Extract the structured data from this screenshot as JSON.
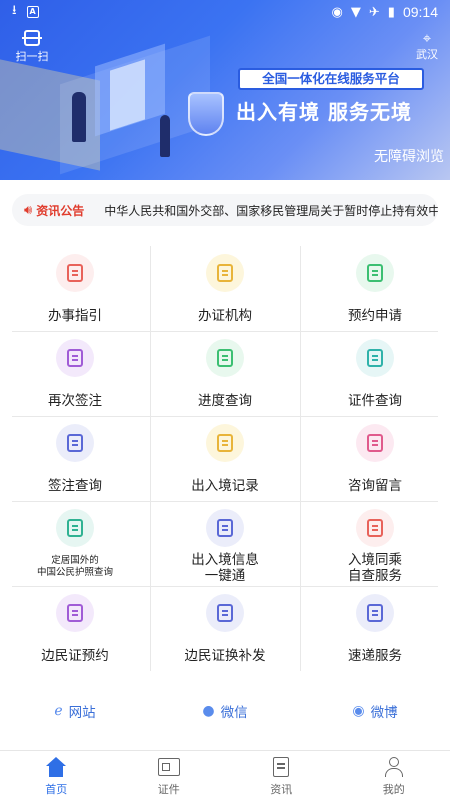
{
  "status_bar": {
    "time": "09:14",
    "a_icon_letter": "A"
  },
  "header": {
    "scan_label": "扫一扫",
    "city": "武汉",
    "platform_tag": "全国一体化在线服务平台",
    "slogan": "出入有境  服务无境",
    "accessibility": "无障碍浏览"
  },
  "notice": {
    "tag": "资讯公告",
    "text": "中华人民共和国外交部、国家移民管理局关于暂时停止持有效中"
  },
  "colors": {
    "accent": "#2f6fe6",
    "notice_red": "#e03c2d",
    "link_blue": "#3a6fd8"
  },
  "services": [
    {
      "label": "办事指引",
      "icon": "guide-icon",
      "bg": "#fdeeee",
      "fg": "#e8625a"
    },
    {
      "label": "办证机构",
      "icon": "building-icon",
      "bg": "#fdf6dc",
      "fg": "#e8b43a"
    },
    {
      "label": "预约申请",
      "icon": "appointment-icon",
      "bg": "#e8f8ee",
      "fg": "#3cbf72"
    },
    {
      "label": "再次签注",
      "icon": "re-endorse-icon",
      "bg": "#f3e9fb",
      "fg": "#a05cd6"
    },
    {
      "label": "进度查询",
      "icon": "progress-icon",
      "bg": "#e8f8ee",
      "fg": "#3cbf72"
    },
    {
      "label": "证件查询",
      "icon": "id-card-icon",
      "bg": "#e6f6f6",
      "fg": "#2fb2aa"
    },
    {
      "label": "签注查询",
      "icon": "endorse-query-icon",
      "bg": "#ebedfa",
      "fg": "#5a68d6"
    },
    {
      "label": "出入境记录",
      "icon": "record-icon",
      "bg": "#fdf6dc",
      "fg": "#e8b43a"
    },
    {
      "label": "咨询留言",
      "icon": "consult-icon",
      "bg": "#fce9f1",
      "fg": "#e05a8c"
    },
    {
      "label_lines": [
        "定居国外的",
        "中国公民护照查询"
      ],
      "icon": "passport-icon",
      "bg": "#e6f6f2",
      "fg": "#2fb292"
    },
    {
      "label_lines": [
        "出入境信息",
        "一键通"
      ],
      "icon": "info-click-icon",
      "bg": "#ebedfa",
      "fg": "#5a68d6"
    },
    {
      "label_lines": [
        "入境同乘",
        "自查服务"
      ],
      "icon": "passenger-check-icon",
      "bg": "#fdeeee",
      "fg": "#e8625a"
    },
    {
      "label": "边民证预约",
      "icon": "border-card-icon",
      "bg": "#f3e9fb",
      "fg": "#a05cd6"
    },
    {
      "label": "边民证换补发",
      "icon": "border-reissue-icon",
      "bg": "#ebedfa",
      "fg": "#5a68d6"
    },
    {
      "label": "速递服务",
      "icon": "delivery-icon",
      "bg": "#ebedfa",
      "fg": "#5a68d6"
    }
  ],
  "links": [
    {
      "label": "网站",
      "icon": "ie-icon"
    },
    {
      "label": "微信",
      "icon": "wechat-icon"
    },
    {
      "label": "微博",
      "icon": "weibo-icon"
    }
  ],
  "tabs": [
    {
      "label": "首页",
      "icon": "home-icon",
      "active": true
    },
    {
      "label": "证件",
      "icon": "card-icon",
      "active": false
    },
    {
      "label": "资讯",
      "icon": "news-icon",
      "active": false
    },
    {
      "label": "我的",
      "icon": "profile-icon",
      "active": false
    }
  ]
}
